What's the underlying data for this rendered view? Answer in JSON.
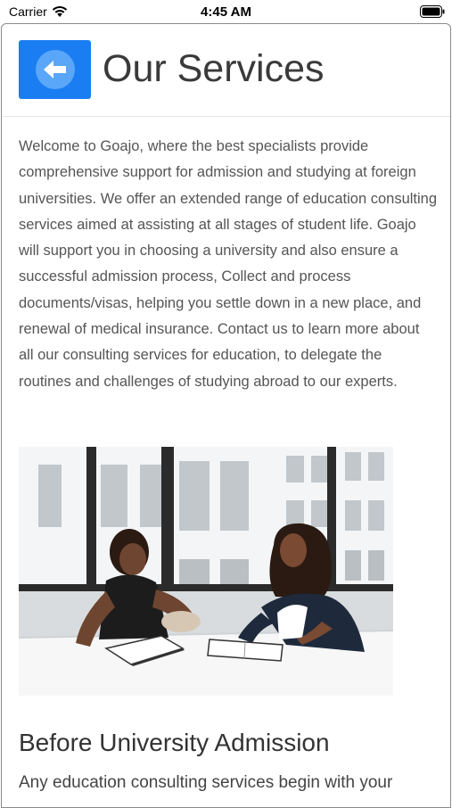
{
  "status_bar": {
    "carrier": "Carrier",
    "time": "4:45 AM"
  },
  "header": {
    "title": "Our Services",
    "back_icon": "arrow-left-icon",
    "accent_color": "#1a7ef2"
  },
  "intro": {
    "text": "Welcome to Goajo, where the best specialists provide comprehensive support for admission and studying at foreign universities. We offer an extended range of education consulting services aimed at assisting at all stages of student life. Goajo will support you in choosing a university and also ensure a successful admission process, Collect and process documents/visas, helping you settle down in a new place, and renewal of medical insurance. Contact us to learn more about all our consulting services for education, to delegate the routines and challenges of studying abroad to our experts."
  },
  "section": {
    "title": "Before University Admission",
    "text": "Any education consulting services begin with your"
  }
}
